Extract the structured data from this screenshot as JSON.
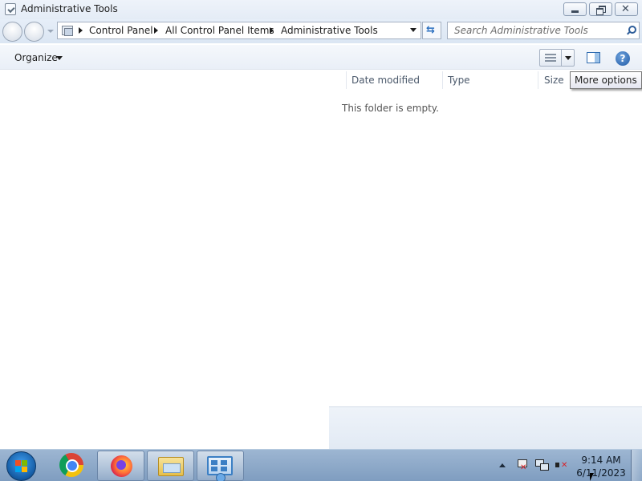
{
  "window": {
    "title": "Administrative Tools"
  },
  "nav": {
    "breadcrumbs": [
      "Control Panel",
      "All Control Panel Items",
      "Administrative Tools"
    ],
    "search_placeholder": "Search Administrative Tools"
  },
  "toolbar": {
    "organize_label": "Organize"
  },
  "content": {
    "columns": [
      "Date modified",
      "Type",
      "Size"
    ],
    "empty_message": "This folder is empty."
  },
  "tooltip": {
    "text": "More options"
  },
  "taskbar": {
    "pinned_apps": [
      "chrome-icon",
      "firefox-icon",
      "windows-explorer-icon",
      "control-panel-icon"
    ],
    "clock_time": "9:14 AM",
    "clock_date": "6/11/2023"
  },
  "colors": {
    "title_bar": "#e4ecf6",
    "taskbar": "#8fa9c8",
    "accent": "#2d5d9a",
    "tray_error": "#d8232a"
  }
}
